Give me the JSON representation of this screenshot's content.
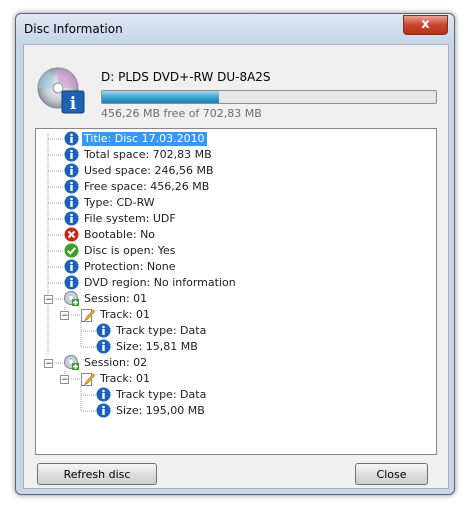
{
  "window": {
    "title": "Disc Information",
    "close_label": "x"
  },
  "drive": {
    "name": "D: PLDS DVD+-RW DU-8A2S",
    "free_text": "456,26 MB free of 702,83 MB",
    "used_fraction": 0.351
  },
  "tree": {
    "items": [
      {
        "label": "Title: Disc 17.03.2010",
        "icon": "info-icon"
      },
      {
        "label": "Total space: 702,83 MB",
        "icon": "info-icon"
      },
      {
        "label": "Used space: 246,56 MB",
        "icon": "info-icon"
      },
      {
        "label": "Free space: 456,26 MB",
        "icon": "info-icon"
      },
      {
        "label": "Type: CD-RW",
        "icon": "info-icon"
      },
      {
        "label": "File system: UDF",
        "icon": "info-icon"
      },
      {
        "label": "Bootable: No",
        "icon": "error-icon"
      },
      {
        "label": "Disc is open: Yes",
        "icon": "check-icon"
      },
      {
        "label": "Protection: None",
        "icon": "info-icon"
      },
      {
        "label": "DVD region: No information",
        "icon": "info-icon"
      }
    ],
    "sessions": [
      {
        "label": "Session: 01",
        "track": "Track: 01",
        "type": "Track type: Data",
        "size": "Size: 15,81 MB"
      },
      {
        "label": "Session: 02",
        "track": "Track: 01",
        "type": "Track type: Data",
        "size": "Size: 195,00 MB"
      }
    ]
  },
  "buttons": {
    "refresh": "Refresh disc",
    "close": "Close"
  },
  "colors": {
    "info": "#1f62b3",
    "error": "#c8261a",
    "check": "#3d9c2a",
    "selection": "#3399ff"
  }
}
